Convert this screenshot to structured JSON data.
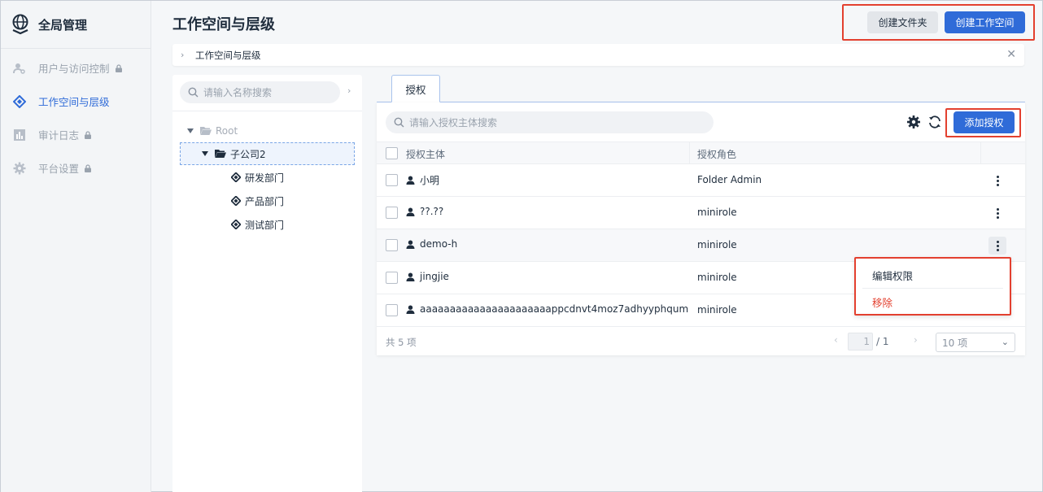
{
  "brand": {
    "title": "全局管理"
  },
  "sidebar": {
    "items": [
      {
        "label": "用户与访问控制",
        "locked": true
      },
      {
        "label": "工作空间与层级",
        "locked": false,
        "active": true
      },
      {
        "label": "审计日志",
        "locked": true
      },
      {
        "label": "平台设置",
        "locked": true
      }
    ]
  },
  "header": {
    "title": "工作空间与层级",
    "create_folder_label": "创建文件夹",
    "create_workspace_label": "创建工作空间"
  },
  "breadcrumb": {
    "current": "工作空间与层级"
  },
  "tree": {
    "search_placeholder": "请输入名称搜索",
    "nodes": {
      "root": "Root",
      "sub": "子公司2",
      "dept1": "研发部门",
      "dept2": "产品部门",
      "dept3": "测试部门"
    }
  },
  "tabs": [
    {
      "label": "授权"
    }
  ],
  "table": {
    "search_placeholder": "请输入授权主体搜索",
    "add_label": "添加授权",
    "columns": {
      "principal": "授权主体",
      "role": "授权角色"
    },
    "rows": [
      {
        "name": "小明",
        "role": "Folder Admin"
      },
      {
        "name": "??.??",
        "role": "minirole"
      },
      {
        "name": "demo-h",
        "role": "minirole"
      },
      {
        "name": "jingjie",
        "role": "minirole"
      },
      {
        "name": "aaaaaaaaaaaaaaaaaaaaaappcdnvt4moz7adhyyphqum",
        "role": "minirole"
      }
    ],
    "total": "共 5 项",
    "page_current": "1",
    "page_total": "/ 1",
    "page_size": "10 项"
  },
  "context_menu": {
    "edit_label": "编辑权限",
    "remove_label": "移除"
  },
  "colors": {
    "accent": "#2f6bd8",
    "danger": "#e3402f",
    "highlight": "#e3402f"
  }
}
